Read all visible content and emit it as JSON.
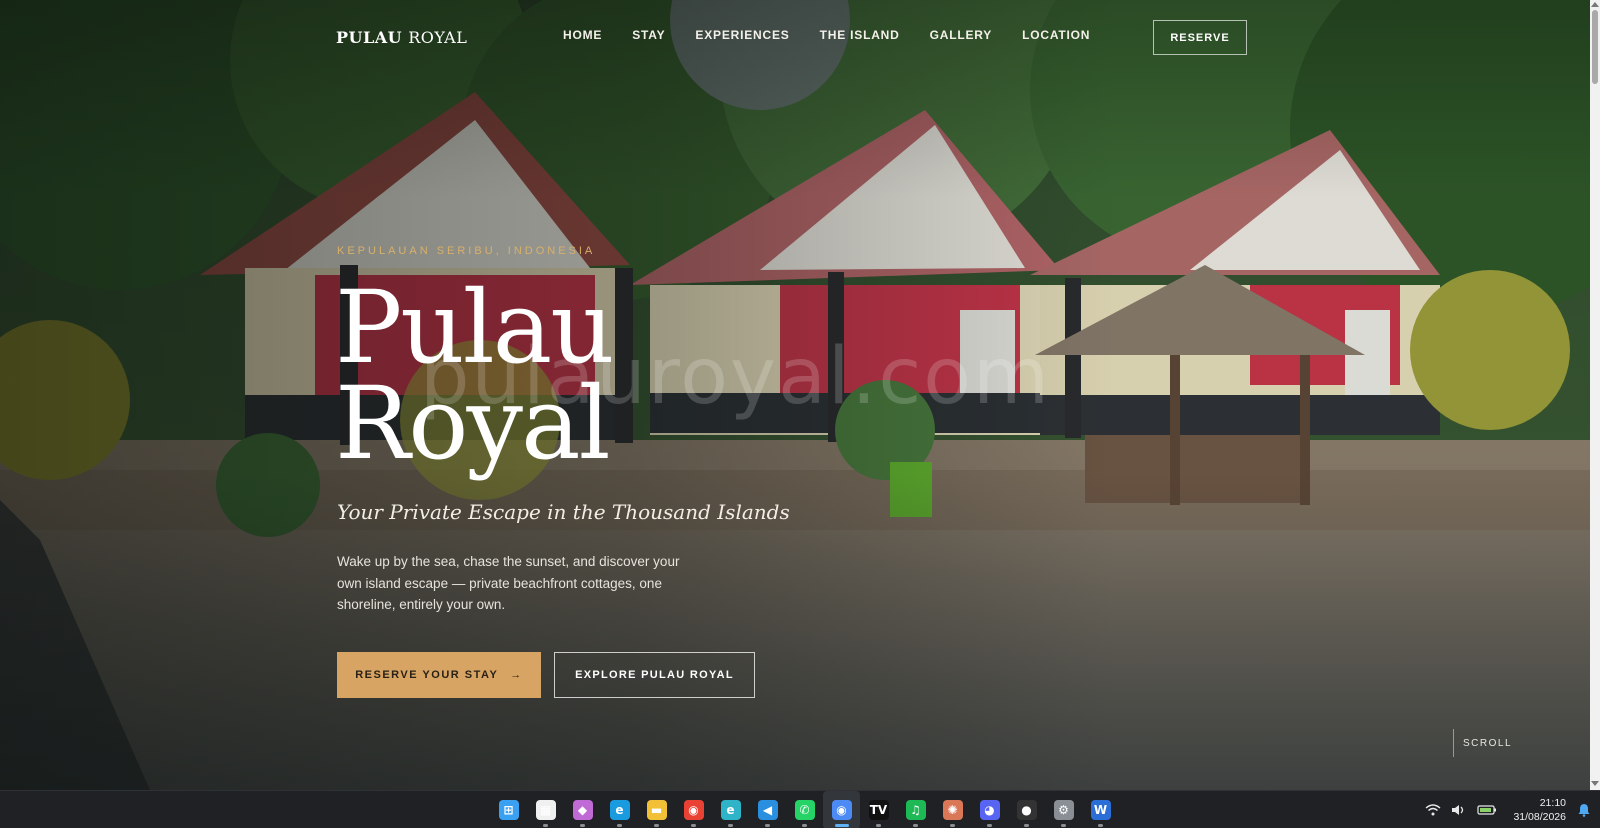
{
  "nav": {
    "brand_bold": "PULAU",
    "brand_light": "ROYAL",
    "links": [
      "HOME",
      "STAY",
      "EXPERIENCES",
      "THE ISLAND",
      "GALLERY",
      "LOCATION"
    ],
    "reserve_label": "RESERVE"
  },
  "hero": {
    "eyebrow": "KEPULAUAN SERIBU, INDONESIA",
    "title_line1": "Pulau",
    "title_line2": "Royal",
    "subtitle": "Your Private Escape in the Thousand Islands",
    "description": "Wake up by the sea, chase the sunset, and discover your own island escape — private beachfront cottages, one shoreline, entirely your own.",
    "primary_cta": "RESERVE YOUR STAY",
    "primary_cta_arrow": "→",
    "secondary_cta": "EXPLORE PULAU ROYAL",
    "watermark": "pulauroyal.com",
    "scroll_label": "SCROLL"
  },
  "colors": {
    "accent_gold": "#d7a463",
    "eyebrow_gold": "#d8b06a",
    "taskbar_bg": "#1f2124"
  },
  "taskbar": {
    "apps": [
      {
        "name": "start-icon",
        "glyph": "⊞",
        "color": "#3aa0f2"
      },
      {
        "name": "store-icon",
        "glyph": "▦",
        "color": "#f0f0f0"
      },
      {
        "name": "copilot-icon",
        "glyph": "◆",
        "color": "#c06ad6"
      },
      {
        "name": "edge-icon",
        "glyph": "e",
        "color": "#1a9be0"
      },
      {
        "name": "file-explorer-icon",
        "glyph": "▬",
        "color": "#f2c037"
      },
      {
        "name": "chrome-icon",
        "glyph": "◉",
        "color": "#e94235"
      },
      {
        "name": "edge-beta-icon",
        "glyph": "e",
        "color": "#2fb3c9"
      },
      {
        "name": "vscode-icon",
        "glyph": "◀",
        "color": "#2b8fe0"
      },
      {
        "name": "whatsapp-icon",
        "glyph": "✆",
        "color": "#25d366"
      },
      {
        "name": "chrome-active-icon",
        "glyph": "◉",
        "color": "#4c8bf5"
      },
      {
        "name": "tradingview-icon",
        "glyph": "TV",
        "color": "#111111"
      },
      {
        "name": "spotify-icon",
        "glyph": "♫",
        "color": "#1db954"
      },
      {
        "name": "claude-icon",
        "glyph": "✺",
        "color": "#d97757"
      },
      {
        "name": "discord-icon",
        "glyph": "◕",
        "color": "#5865f2"
      },
      {
        "name": "recorder-icon",
        "glyph": "●",
        "color": "#333333"
      },
      {
        "name": "settings-icon",
        "glyph": "⚙",
        "color": "#8a8f96"
      },
      {
        "name": "word-icon",
        "glyph": "W",
        "color": "#2b6fd6"
      }
    ],
    "active_index": 9,
    "time": "21:10",
    "date": "31/08/2026"
  }
}
